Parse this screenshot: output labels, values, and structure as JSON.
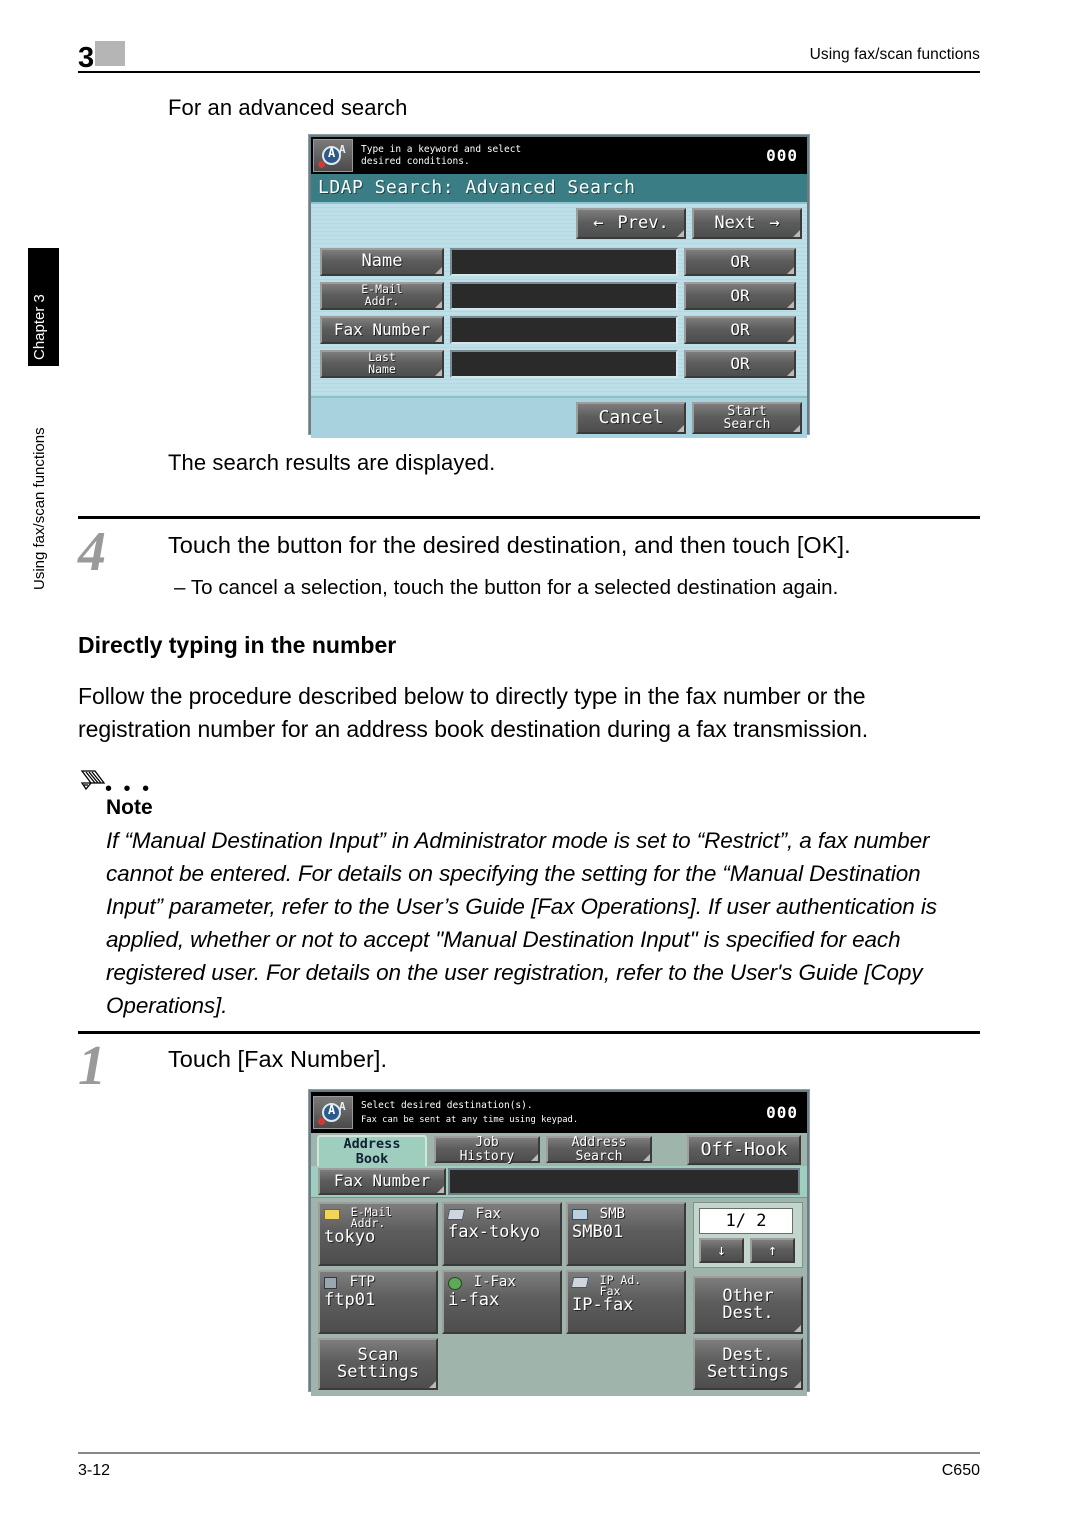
{
  "header": {
    "chapter_number": "3",
    "running_head": "Using fax/scan functions"
  },
  "side": {
    "chapter_tab": "Chapter 3",
    "section_label": "Using fax/scan functions"
  },
  "content": {
    "subhead": "For an advanced search",
    "results_line": "The search results are displayed.",
    "step4": {
      "number": "4",
      "title": "Touch the button for the desired destination, and then touch [OK].",
      "bullet": "–  To cancel a selection, touch the button for a selected destination again."
    },
    "section_heading": "Directly typing in the number",
    "paragraph": "Follow the procedure described below to directly type in the fax number or the registration number for an address book destination during a fax transmission.",
    "note": {
      "dots": "• • •",
      "title": "Note",
      "body": "If “Manual Destination Input” in Administrator mode is set to “Restrict”, a fax number cannot be entered. For details on specifying the setting for the “Manual Destination Input” parameter, refer to the User’s Guide [Fax Operations]. If user authentication is applied, whether or not to accept \"Manual Destination Input\" is specified for each registered user. For details on the user registration, refer to the User's Guide [Copy Operations]."
    },
    "step1": {
      "number": "1",
      "title": "Touch [Fax Number]."
    }
  },
  "panel1": {
    "status_line1": "Type in a keyword and select",
    "status_line2": "desired conditions.",
    "counter": "000",
    "title": "LDAP Search: Advanced Search",
    "prev_label": "Prev.",
    "next_label": "Next",
    "rows": [
      {
        "label": "Name",
        "value": "",
        "operator": "OR"
      },
      {
        "label": "E-Mail\nAddr.",
        "value": "",
        "operator": "OR"
      },
      {
        "label": "Fax Number",
        "value": "",
        "operator": "OR"
      },
      {
        "label": "Last\nName",
        "value": "",
        "operator": "OR"
      }
    ],
    "cancel_label": "Cancel",
    "start_search_label": "Start\nSearch"
  },
  "panel2": {
    "status_line1": "Select desired destination(s).",
    "status_line2": "Fax can be sent at any time using keypad.",
    "counter": "000",
    "tabs": [
      {
        "label": "Address\nBook",
        "active": true
      },
      {
        "label": "Job\nHistory",
        "active": false
      },
      {
        "label": "Address\nSearch",
        "active": false
      }
    ],
    "off_hook_label": "Off-Hook",
    "fax_number_label": "Fax Number",
    "fax_number_value": "",
    "destinations": [
      {
        "type": "E-Mail\nAddr.",
        "name": "tokyo",
        "icon": "envelope-icon"
      },
      {
        "type": "Fax",
        "name": "fax-tokyo",
        "icon": "fax-icon"
      },
      {
        "type": "SMB",
        "name": "SMB01",
        "icon": "monitor-icon"
      },
      {
        "type": "FTP",
        "name": "ftp01",
        "icon": "server-icon"
      },
      {
        "type": "I-Fax",
        "name": "i-fax",
        "icon": "globe-icon"
      },
      {
        "type": "IP Ad.\nFax",
        "name": "IP-fax",
        "icon": "ipfax-icon"
      }
    ],
    "page_indicator": "1/   2",
    "scroll_down": "↓",
    "scroll_up": "↑",
    "other_dest_label": "Other\nDest.",
    "scan_settings_label": "Scan\nSettings",
    "dest_settings_label": "Dest.\nSettings"
  },
  "footer": {
    "page_number": "3-12",
    "model": "C650"
  }
}
